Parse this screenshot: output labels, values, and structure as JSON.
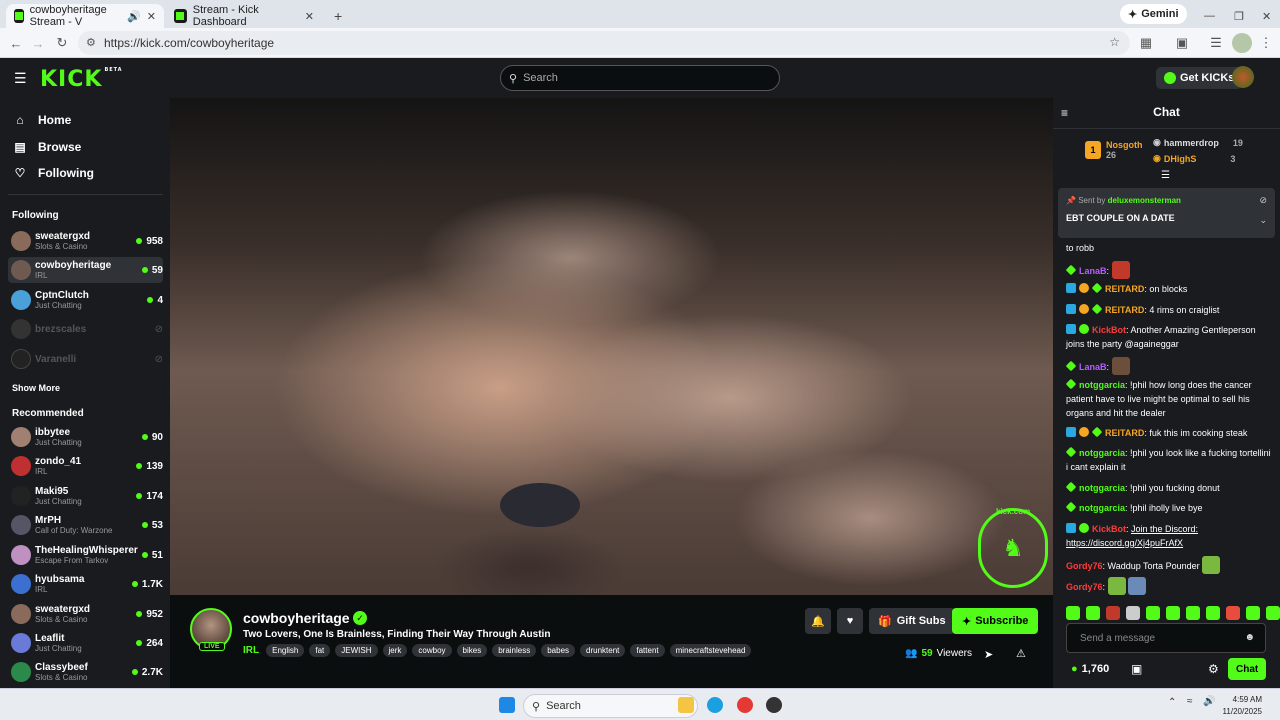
{
  "browser": {
    "tabs": [
      {
        "title": "cowboyheritage Stream - V"
      },
      {
        "title": "Stream - Kick Dashboard"
      }
    ],
    "url": "https://kick.com/cowboyheritage",
    "gemini_label": "Gemini"
  },
  "header": {
    "logo": "KICK",
    "logo_badge": "BETA",
    "search_placeholder": "Search",
    "get_kicks_label": "Get KICKs"
  },
  "sidebar": {
    "nav": [
      {
        "label": "Home",
        "icon": "home-icon"
      },
      {
        "label": "Browse",
        "icon": "browse-icon"
      },
      {
        "label": "Following",
        "icon": "heart-icon"
      }
    ],
    "following_title": "Following",
    "following": [
      {
        "name": "sweatergxd",
        "category": "Slots & Casino",
        "viewers": "958"
      },
      {
        "name": "cowboyheritage",
        "category": "IRL",
        "viewers": "59"
      },
      {
        "name": "CptnClutch",
        "category": "Just Chatting",
        "viewers": "4"
      },
      {
        "name": "brezscales",
        "category": "",
        "viewers": ""
      },
      {
        "name": "Varanelli",
        "category": "",
        "viewers": ""
      }
    ],
    "show_more": "Show More",
    "recommended_title": "Recommended",
    "recommended": [
      {
        "name": "ibbytee",
        "category": "Just Chatting",
        "viewers": "90"
      },
      {
        "name": "zondo_41",
        "category": "IRL",
        "viewers": "139"
      },
      {
        "name": "Maki95",
        "category": "Just Chatting",
        "viewers": "174"
      },
      {
        "name": "MrPH",
        "category": "Call of Duty: Warzone",
        "viewers": "53"
      },
      {
        "name": "TheHealingWhisperer",
        "category": "Escape From Tarkov",
        "viewers": "51"
      },
      {
        "name": "hyubsama",
        "category": "IRL",
        "viewers": "1.7K"
      },
      {
        "name": "sweatergxd",
        "category": "Slots & Casino",
        "viewers": "952"
      },
      {
        "name": "Leaflit",
        "category": "Just Chatting",
        "viewers": "264"
      },
      {
        "name": "Classybeef",
        "category": "Slots & Casino",
        "viewers": "2.7K"
      }
    ]
  },
  "video": {
    "watermark": "kick.com"
  },
  "stream": {
    "streamer": "cowboyheritage",
    "live": "LIVE",
    "title": "Two Lovers, One Is Brainless, Finding Their Way Through Austin",
    "category": "IRL",
    "tags": [
      "English",
      "fat",
      "JEWISH",
      "jerk",
      "cowboy",
      "bikes",
      "brainless",
      "babes",
      "drunktent",
      "fattent",
      "minecraftstevehead"
    ],
    "gift_label": "Gift Subs",
    "subscribe_label": "Subscribe",
    "viewers_count": "59",
    "viewers_label": "Viewers"
  },
  "chat": {
    "title": "Chat",
    "leaderboard": [
      {
        "rank": "1",
        "name": "Nosgoth",
        "count": "26"
      },
      {
        "name": "hammerdrop",
        "count": "19"
      },
      {
        "name": "DHighS",
        "count": "3"
      }
    ],
    "pinned": {
      "sent_by_prefix": "Sent by",
      "sent_by_user": "deluxemonsterman",
      "text": "EBT COUPLE ON A DATE"
    },
    "messages": [
      {
        "user": "",
        "text": "to robb",
        "color": "#ffffff"
      },
      {
        "user": "LanaB",
        "text": "",
        "color": "#b85cff"
      },
      {
        "user": "REITARD",
        "text": "on blocks",
        "color": "#f5a623"
      },
      {
        "user": "REITARD",
        "text": "4 rims on craiglist",
        "color": "#f5a623"
      },
      {
        "user": "KickBot",
        "text": "Another Amazing Gentleperson joins the party @againeggar",
        "color": "#ff3b3b"
      },
      {
        "user": "LanaB",
        "text": "",
        "color": "#b85cff"
      },
      {
        "user": "notggarcia",
        "text": "!phil how long does the cancer patient have to live might be optimal to sell his organs and hit the dealer",
        "color": "#53fc18"
      },
      {
        "user": "REITARD",
        "text": "fuk this im cooking steak",
        "color": "#f5a623"
      },
      {
        "user": "notggarcia",
        "text": "!phil you look like a fucking tortellini i cant explain it",
        "color": "#53fc18"
      },
      {
        "user": "notggarcia",
        "text": "!phil you fucking donut",
        "color": "#53fc18"
      },
      {
        "user": "notggarcia",
        "text": "!phil iholly live bye",
        "color": "#53fc18"
      },
      {
        "user": "KickBot",
        "text": "Join the Discord: https://discord.gg/Xj4puFrAfX",
        "color": "#ff3b3b"
      },
      {
        "user": "Gordy76",
        "text": "Waddup Torta Pounder",
        "color": "#ff3b3b"
      },
      {
        "user": "Gordy76",
        "text": "",
        "color": "#ff3b3b"
      }
    ],
    "input_placeholder": "Send a message",
    "points": "1,760",
    "send_label": "Chat"
  },
  "taskbar": {
    "search_label": "Search",
    "time": "4:59 AM",
    "date": "11/20/2025"
  }
}
